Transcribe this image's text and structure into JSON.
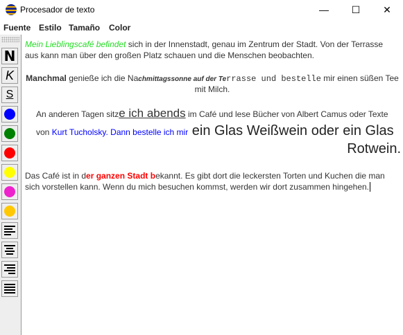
{
  "window": {
    "title": "Procesador de texto",
    "minimize": "—",
    "maximize": "☐",
    "close": "✕"
  },
  "menu": [
    "Fuente",
    "Estilo",
    "Tamaño",
    "Color"
  ],
  "toolbar": {
    "bold": "N",
    "italic": "K",
    "underline": "S",
    "colors": [
      "#0000ff",
      "#008000",
      "#ff0000",
      "#ffff00",
      "#ee22cc",
      "#ffc800"
    ],
    "align": [
      "align-left",
      "align-center",
      "align-right",
      "justify"
    ]
  },
  "document": {
    "p1": {
      "green": "Mein Lieblingscafé befindet",
      "rest1": " sich in der Innenstadt, genau im Zentrum der Stadt. Von der Terrasse",
      "line2": "aus kann man über den großen Platz schauen und die Menschen beobachten."
    },
    "p2": {
      "bold": "Manchmal",
      "a": " genieße ich die Na",
      "bi": "chmittagssonne auf der Te",
      "mono": "rrasse und bestelle",
      "b": " mir einen süßen Tee",
      "line2": "mit Milch."
    },
    "p3": {
      "a": "An anderen Tagen sitz",
      "big": "e ich abends",
      "b": " im Café und lese Bücher von Albert Camus oder Texte",
      "c": "von ",
      "blue": "Kurt Tucholsky. Dann bestelle ich mir",
      "large": " ein Glas Weißwein oder ein Glas",
      "large2": "Rotwein."
    },
    "p4": {
      "a": "Das Café ist in d",
      "red": "er ganzen Stadt b",
      "b": "ekannt. Es gibt dort die leckersten Torten und Kuchen die man",
      "line2": "sich vorstellen kann. Wenn du mich besuchen kommst, werden wir dort zusammen hingehen."
    }
  }
}
